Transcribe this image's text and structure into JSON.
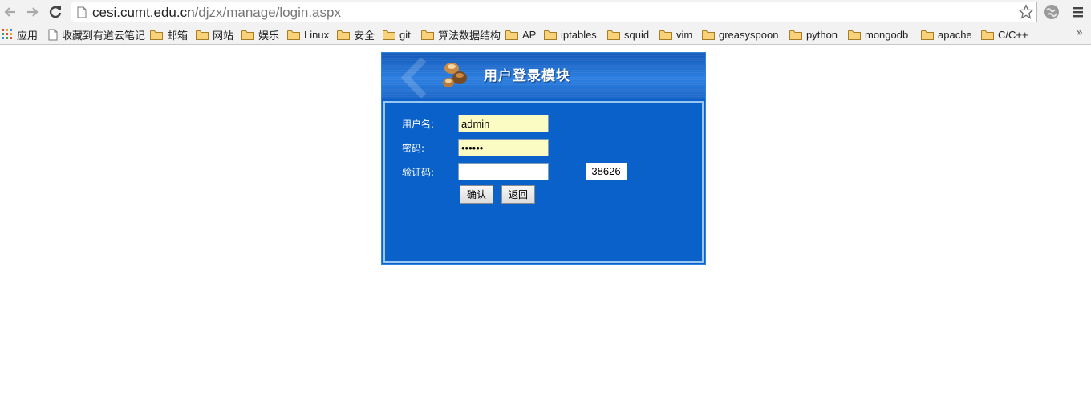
{
  "browser": {
    "url_host": "cesi.cumt.edu.cn",
    "url_path": "/djzx/manage/login.aspx",
    "back_icon": "back-arrow-icon",
    "forward_icon": "forward-arrow-icon",
    "reload_icon": "reload-icon"
  },
  "bookmarks": {
    "apps_label": "应用",
    "items": [
      {
        "label": "收藏到有道云笔记",
        "icon": "page-icon"
      },
      {
        "label": "邮箱",
        "icon": "folder-icon"
      },
      {
        "label": "网站",
        "icon": "folder-icon"
      },
      {
        "label": "娱乐",
        "icon": "folder-icon"
      },
      {
        "label": "Linux",
        "icon": "folder-icon"
      },
      {
        "label": "安全",
        "icon": "folder-icon"
      },
      {
        "label": "git",
        "icon": "folder-icon"
      },
      {
        "label": "算法数据结构",
        "icon": "folder-icon"
      },
      {
        "label": "AP",
        "icon": "folder-icon"
      },
      {
        "label": "iptables",
        "icon": "folder-icon"
      },
      {
        "label": "squid",
        "icon": "folder-icon"
      },
      {
        "label": "vim",
        "icon": "folder-icon"
      },
      {
        "label": "greasyspoon",
        "icon": "folder-icon"
      },
      {
        "label": "python",
        "icon": "folder-icon"
      },
      {
        "label": "mongodb",
        "icon": "folder-icon"
      },
      {
        "label": "apache",
        "icon": "folder-icon"
      },
      {
        "label": "C/C++",
        "icon": "folder-icon"
      }
    ],
    "more": "»"
  },
  "login": {
    "title": "用户登录模块",
    "username_label": "用户名:",
    "username_value": "admin",
    "password_label": "密码:",
    "password_value": "••••••",
    "captcha_label": "验证码:",
    "captcha_input_value": "",
    "captcha_code": "38626",
    "confirm_label": "确认",
    "back_label": "返回"
  },
  "colors": {
    "panel_bg": "#0a61c9",
    "input_filled": "#fbfbc4",
    "panel_border": "#9cc6f2"
  }
}
